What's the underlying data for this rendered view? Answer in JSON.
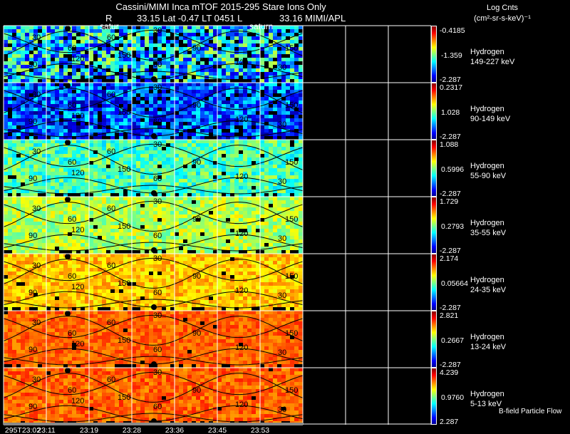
{
  "header": {
    "line1": "Cassini/MIMI Inca mTOF  2015-295   Stare   Ions Only",
    "line2_r": "R",
    "line2_mid": "33.15 Lat -0.47 LT 0451 L",
    "line2_right": "33.16  MIMI/APL",
    "units_title": "Log Cnts",
    "units": "(cm²-sr-s-keV)⁻¹",
    "marker_labels": [
      "satur",
      "saturn"
    ],
    "footer_note": "B-field Particle Flow"
  },
  "chart_data": {
    "type": "heatmap",
    "x_tick_labels": [
      "295T23:02",
      "23:11",
      "23:19",
      "23:28",
      "23:36",
      "23:45",
      "23:53"
    ],
    "contour_levels": [
      30,
      60,
      90,
      120,
      150
    ],
    "colormap": "jet",
    "grid": true,
    "panels": [
      {
        "species": "Hydrogen",
        "energy": "149-227 keV",
        "cbar_max": "-0.4185",
        "cbar_mid": "-1.359",
        "cbar_min": "-2.287"
      },
      {
        "species": "Hydrogen",
        "energy": "90-149 keV",
        "cbar_max": "0.2317",
        "cbar_mid": "1.028",
        "cbar_min": "-2.287"
      },
      {
        "species": "Hydrogen",
        "energy": "55-90 keV",
        "cbar_max": "1.088",
        "cbar_mid": "0.5996",
        "cbar_min": "-2.287"
      },
      {
        "species": "Hydrogen",
        "energy": "35-55 keV",
        "cbar_max": "1.729",
        "cbar_mid": "0.2793",
        "cbar_min": "-2.287"
      },
      {
        "species": "Hydrogen",
        "energy": "24-35 keV",
        "cbar_max": "2.174",
        "cbar_mid": "0.05664",
        "cbar_min": "-2.287"
      },
      {
        "species": "Hydrogen",
        "energy": "13-24 keV",
        "cbar_max": "2.821",
        "cbar_mid": "0.2667",
        "cbar_min": "-2.287"
      },
      {
        "species": "Hydrogen",
        "energy": "5-13 keV",
        "cbar_max": "4.239",
        "cbar_mid": "0.9760",
        "cbar_min": "2.287"
      }
    ]
  }
}
